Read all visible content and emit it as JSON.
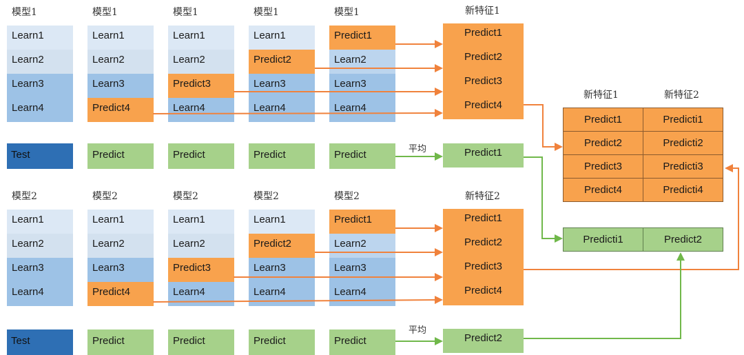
{
  "block1": {
    "headers": [
      "模型1",
      "模型1",
      "模型1",
      "模型1",
      "模型1"
    ],
    "folds": [
      [
        "Learn1",
        "Learn2",
        "Learn3",
        "Learn4"
      ],
      [
        "Learn1",
        "Learn2",
        "Learn3",
        "Predict4"
      ],
      [
        "Learn1",
        "Learn2",
        "Predict3",
        "Learn4"
      ],
      [
        "Learn1",
        "Predict2",
        "Learn3",
        "Learn4"
      ],
      [
        "Predict1",
        "Learn2",
        "Learn3",
        "Learn4"
      ]
    ],
    "new_feature_header": "新特征1",
    "new_feature": [
      "Predict1",
      "Predict2",
      "Predict3",
      "Predict4"
    ],
    "test_label": "Test",
    "test_predictions": [
      "Predict",
      "Predict",
      "Predict",
      "Predict"
    ],
    "average_label": "平均",
    "test_feature": "Predict1"
  },
  "block2": {
    "headers": [
      "模型2",
      "模型2",
      "模型2",
      "模型2",
      "模型2"
    ],
    "folds": [
      [
        "Learn1",
        "Learn2",
        "Learn3",
        "Learn4"
      ],
      [
        "Learn1",
        "Learn2",
        "Learn3",
        "Predict4"
      ],
      [
        "Learn1",
        "Learn2",
        "Predict3",
        "Learn4"
      ],
      [
        "Learn1",
        "Predict2",
        "Learn3",
        "Learn4"
      ],
      [
        "Predict1",
        "Learn2",
        "Learn3",
        "Learn4"
      ]
    ],
    "new_feature_header": "新特征2",
    "new_feature": [
      "Predict1",
      "Predict2",
      "Predict3",
      "Predict4"
    ],
    "test_label": "Test",
    "test_predictions": [
      "Predict",
      "Predict",
      "Predict",
      "Predict"
    ],
    "average_label": "平均",
    "test_feature": "Predict2"
  },
  "train_table": {
    "headers": [
      "新特征1",
      "新特征2"
    ],
    "rows": [
      [
        "Predict1",
        "Predicti1"
      ],
      [
        "Predict2",
        "Predicti2"
      ],
      [
        "Predict3",
        "Predicti3"
      ],
      [
        "Predict4",
        "Predicti4"
      ]
    ]
  },
  "test_table": {
    "row": [
      "Predicti1",
      "Predict2"
    ]
  },
  "colors": {
    "learn_light": "#dce8f5",
    "learn_dark": "#9dc2e6",
    "predict_orange": "#f8a24d",
    "predict_green": "#a6d18a",
    "test_blue": "#2e6fb4",
    "arrow_orange": "#f0823c",
    "arrow_green": "#70b84a"
  }
}
